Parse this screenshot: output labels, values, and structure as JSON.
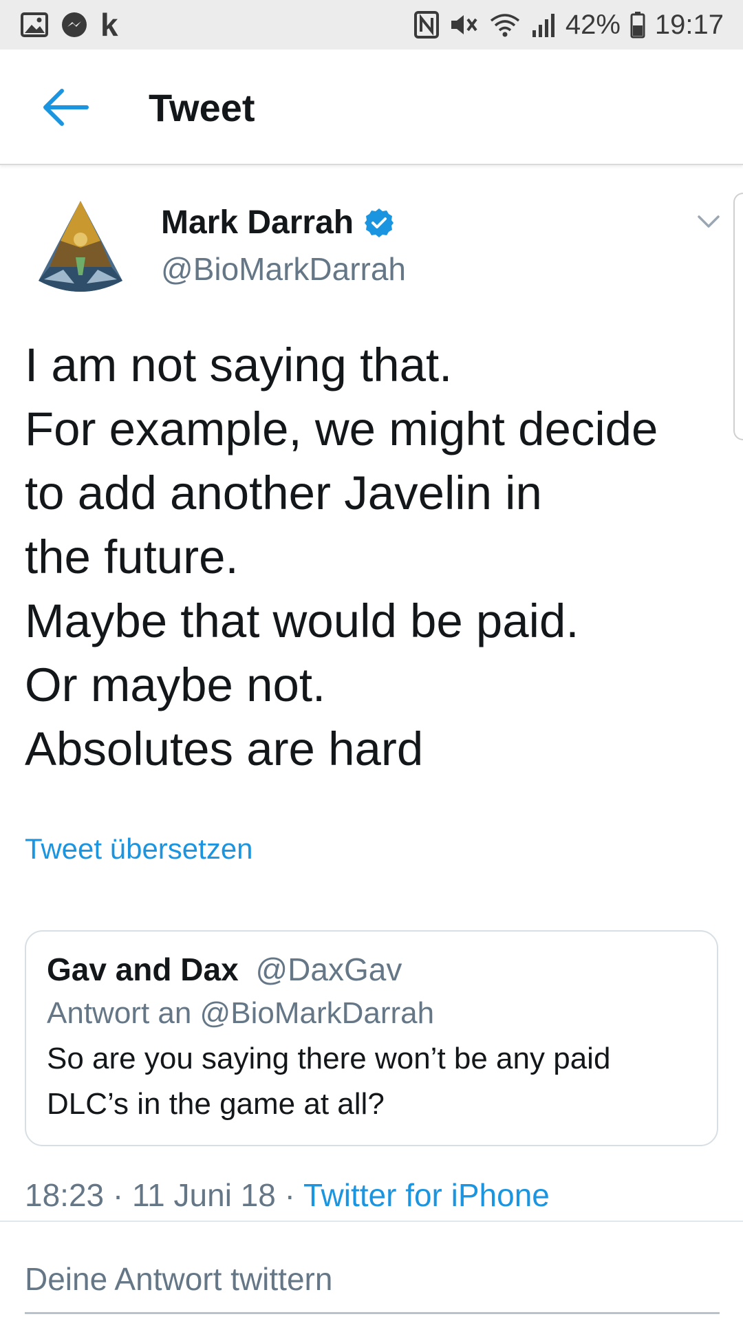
{
  "status_bar": {
    "battery_percent": "42%",
    "time": "19:17",
    "left_icons": [
      "gallery-icon",
      "messenger-icon",
      "k-app-icon"
    ],
    "right_icons": [
      "nfc-icon",
      "mute-icon",
      "wifi-icon",
      "signal-icon",
      "battery-icon"
    ],
    "k_glyph": "k"
  },
  "toolbar": {
    "title": "Tweet"
  },
  "tweet": {
    "author_name": "Mark Darrah",
    "author_handle": "@BioMarkDarrah",
    "verified": true,
    "lines": [
      "I am not saying that.",
      "For example, we might decide",
      "to add another Javelin in",
      "the future.",
      "Maybe that would be paid.",
      "Or maybe not.",
      "Absolutes are hard"
    ],
    "translate_label": "Tweet übersetzen"
  },
  "quoted_tweet": {
    "name": "Gav and Dax",
    "handle": "@DaxGav",
    "reply_to": "Antwort an @BioMarkDarrah",
    "text": "So are you saying there won’t be any paid DLC’s in the game at all?"
  },
  "meta": {
    "time": "18:23",
    "separator": "·",
    "date": "11 Juni 18",
    "source": "Twitter for iPhone"
  },
  "reply": {
    "placeholder": "Deine Antwort twittern"
  },
  "colors": {
    "accent": "#1b95e0",
    "secondary_text": "#657786",
    "primary_text": "#14171a",
    "status_bar_bg": "#ececec"
  }
}
